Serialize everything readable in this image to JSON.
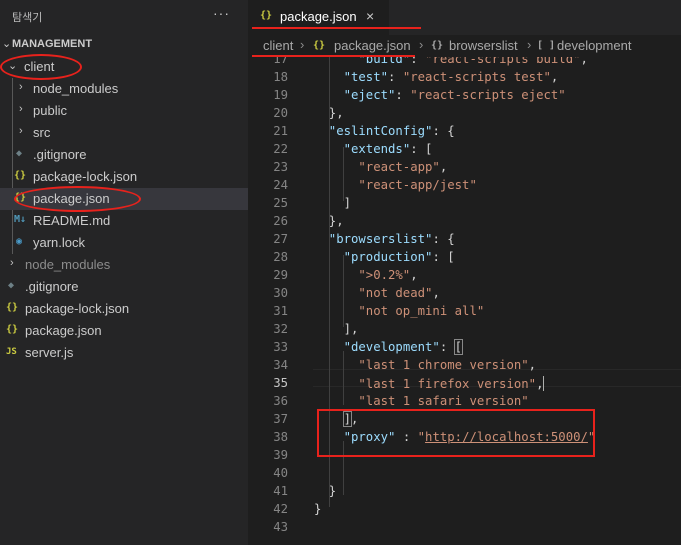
{
  "sidebar": {
    "title": "탐색기",
    "more": "···",
    "workspace": "MANAGEMENT",
    "items": [
      {
        "label": "client",
        "icon": "chevron-down-icon"
      },
      {
        "label": "node_modules",
        "icon": "chevron-right-icon"
      },
      {
        "label": "public",
        "icon": "chevron-right-icon"
      },
      {
        "label": "src",
        "icon": "chevron-right-icon"
      },
      {
        "label": ".gitignore",
        "icon": "gitignore-file-icon"
      },
      {
        "label": "package-lock.json",
        "icon": "json-file-icon"
      },
      {
        "label": "package.json",
        "icon": "json-file-icon",
        "selected": true
      },
      {
        "label": "README.md",
        "icon": "markdown-file-icon"
      },
      {
        "label": "yarn.lock",
        "icon": "yarn-file-icon"
      },
      {
        "label": "node_modules",
        "icon": "chevron-right-icon"
      },
      {
        "label": ".gitignore",
        "icon": "gitignore-file-icon"
      },
      {
        "label": "package-lock.json",
        "icon": "json-file-icon"
      },
      {
        "label": "package.json",
        "icon": "json-file-icon"
      },
      {
        "label": "server.js",
        "icon": "js-file-icon"
      }
    ]
  },
  "tabs": [
    {
      "label": "package.json",
      "icon": "json-file-icon",
      "active": true,
      "close": "×"
    }
  ],
  "icons": {
    "json": "{}",
    "js": "JS",
    "md": "M↓",
    "git": "◆",
    "yarn": "◉",
    "chevron_right": "›",
    "chevron_down": "⌄",
    "array": "[ ]"
  },
  "breadcrumb": [
    {
      "label": "client"
    },
    {
      "label": "package.json"
    },
    {
      "label": "browserslist"
    },
    {
      "label": "development"
    }
  ],
  "editor": {
    "current_line": 35,
    "lines": [
      {
        "n": "17",
        "text": "\"build\": \"react-scripts build\","
      },
      {
        "n": "18",
        "text": "\"test\": \"react-scripts test\","
      },
      {
        "n": "19",
        "text": "\"eject\": \"react-scripts eject\""
      },
      {
        "n": "20",
        "text": "},"
      },
      {
        "n": "21",
        "text": "\"eslintConfig\": {"
      },
      {
        "n": "22",
        "text": "\"extends\": ["
      },
      {
        "n": "23",
        "text": "\"react-app\","
      },
      {
        "n": "24",
        "text": "\"react-app/jest\""
      },
      {
        "n": "25",
        "text": "]"
      },
      {
        "n": "26",
        "text": "},"
      },
      {
        "n": "27",
        "text": "\"browserslist\": {"
      },
      {
        "n": "28",
        "text": "\"production\": ["
      },
      {
        "n": "29",
        "text": "\">0.2%\","
      },
      {
        "n": "30",
        "text": "\"not dead\","
      },
      {
        "n": "31",
        "text": "\"not op_mini all\""
      },
      {
        "n": "32",
        "text": "],"
      },
      {
        "n": "33",
        "text": "\"development\": ["
      },
      {
        "n": "34",
        "text": "\"last 1 chrome version\","
      },
      {
        "n": "35",
        "text": "\"last 1 firefox version\","
      },
      {
        "n": "36",
        "text": "\"last 1 safari version\""
      },
      {
        "n": "37",
        "text": "],"
      },
      {
        "n": "38",
        "text": "\"proxy\" : \"http://localhost:5000/\""
      },
      {
        "n": "39",
        "text": ""
      },
      {
        "n": "40",
        "text": ""
      },
      {
        "n": "41",
        "text": "}"
      },
      {
        "n": "42",
        "text": "}"
      },
      {
        "n": "43",
        "text": ""
      }
    ]
  },
  "colors": {
    "annotation": "#e8221c",
    "json_key": "#9cdcfe",
    "json_string": "#ce9178",
    "json_icon": "#cbcb41"
  }
}
